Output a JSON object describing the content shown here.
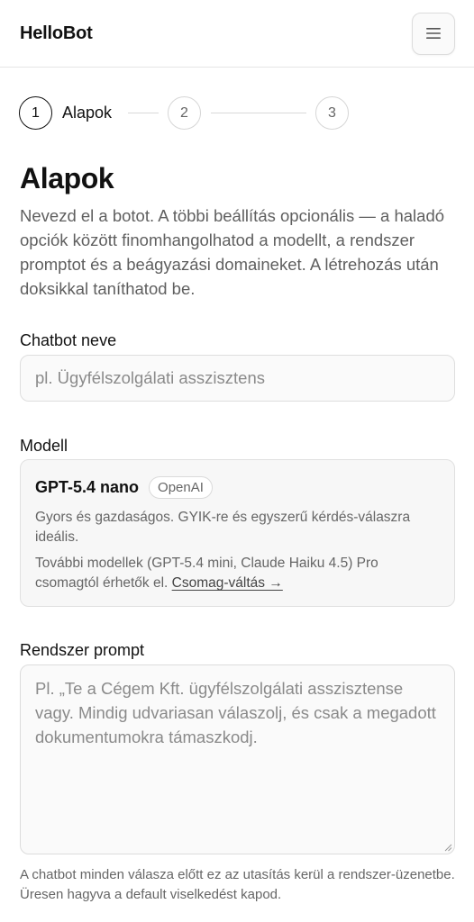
{
  "header": {
    "brand": "HelloBot",
    "menu_icon": "hamburger-menu-icon"
  },
  "stepper": {
    "steps": [
      {
        "number": "1",
        "label": "Alapok",
        "active": true
      },
      {
        "number": "2",
        "label": "",
        "active": false
      },
      {
        "number": "3",
        "label": "",
        "active": false
      }
    ]
  },
  "main": {
    "title": "Alapok",
    "intro": "Nevezd el a botot. A többi beállítás opcionális — a haladó opciók között finomhangolhatod a modellt, a rendszer promptot és a beágyazási domaineket. A létrehozás után doksikkal taníthatod be."
  },
  "form": {
    "name": {
      "label": "Chatbot neve",
      "placeholder": "pl. Ügyfélszolgálati asszisztens",
      "value": ""
    },
    "model": {
      "label": "Modell",
      "name": "GPT-5.4 nano",
      "provider": "OpenAI",
      "description": "Gyors és gazdaságos. GYIK-re és egyszerű kérdés-válaszra ideális.",
      "note": "További modellek (GPT-5.4 mini, Claude Haiku 4.5) Pro csomagtól érhetők el.",
      "upgrade_link": "Csomag-váltás →"
    },
    "system_prompt": {
      "label": "Rendszer prompt",
      "placeholder": "Pl. „Te a Cégem Kft. ügyfélszolgálati asszisztense vagy. Mindig udvariasan válaszolj, és csak a megadott dokumentumokra támaszkodj.",
      "value": "",
      "help": "A chatbot minden válasza előtt ez az utasítás kerül a rendszer-üzenetbe. Üresen hagyva a default viselkedést kapod."
    }
  },
  "colors": {
    "text": "#111111",
    "muted": "#5f5f5f",
    "border": "#dedede",
    "field_bg": "#fafafa"
  }
}
